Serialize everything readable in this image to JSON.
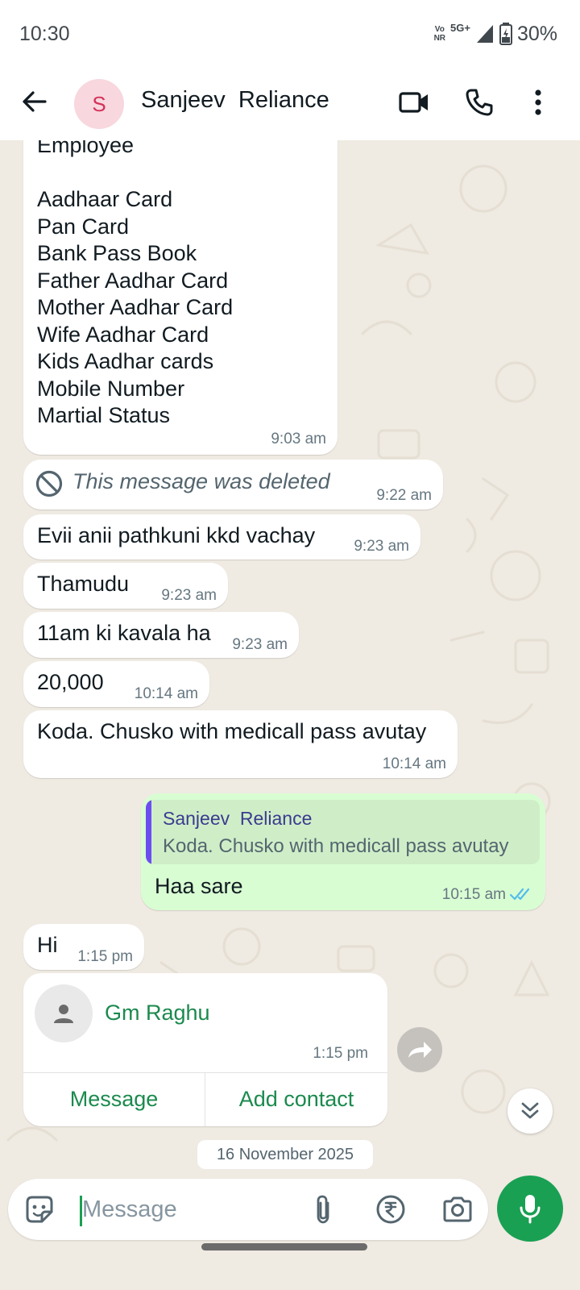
{
  "status_bar": {
    "time": "10:30",
    "volte_top": "Vo",
    "volte_bottom": "NR",
    "network": "5G+",
    "battery": "30%"
  },
  "header": {
    "avatar_letter": "S",
    "contact_name": "Sanjeev  Reliance",
    "icons": [
      "back-arrow-icon",
      "video-call-icon",
      "voice-call-icon",
      "more-options-icon"
    ]
  },
  "messages": {
    "m1": {
      "lines": [
        "Employee",
        "",
        "Aadhaar Card",
        "Pan Card",
        "Bank Pass Book",
        "Father Aadhar Card",
        "Mother Aadhar Card",
        "Wife Aadhar Card",
        "Kids Aadhar cards",
        "Mobile Number",
        "Martial Status"
      ],
      "time": "9:03 am"
    },
    "m2": {
      "text": "This message was deleted",
      "time": "9:22 am"
    },
    "m3": {
      "text": "Evii anii pathkuni kkd vachay",
      "time": "9:23 am"
    },
    "m4": {
      "text": "Thamudu",
      "time": "9:23 am"
    },
    "m5": {
      "text": "11am ki kavala ha",
      "time": "9:23 am"
    },
    "m6": {
      "text": "20,000",
      "time": "10:14 am"
    },
    "m7": {
      "text": "Koda. Chusko with medicall pass avutay",
      "time": "10:14 am"
    },
    "m8": {
      "quote_name": "Sanjeev  Reliance",
      "quote_text": "Koda. Chusko with medicall pass avutay",
      "text": "Haa sare",
      "time": "10:15 am",
      "read_receipt": "double-check-icon"
    },
    "m9": {
      "text": "Hi",
      "time": "1:15 pm"
    },
    "m10": {
      "contact_name": "Gm Raghu",
      "time": "1:15 pm",
      "message_btn": "Message",
      "add_contact_btn": "Add contact"
    }
  },
  "date_chip": "16 November 2025",
  "composer": {
    "placeholder": "Message",
    "icons": [
      "sticker-icon",
      "attach-icon",
      "rupee-payment-icon",
      "camera-icon",
      "mic-icon"
    ]
  },
  "colors": {
    "chat_bg": "#efeae2",
    "outgoing_bubble": "#d9fdd3",
    "accent_green": "#1aa053",
    "link_green": "#1b8a4e",
    "read_tick_blue": "#53bdeb"
  }
}
